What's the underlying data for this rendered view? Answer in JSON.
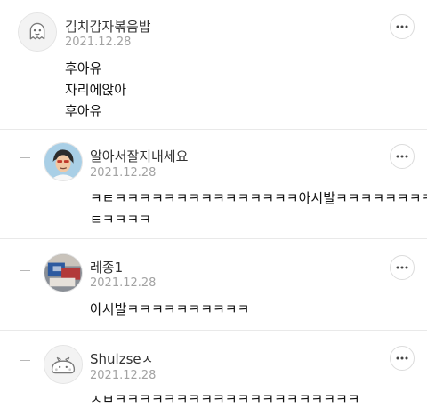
{
  "comments": [
    {
      "author": "김치감자볶음밥",
      "date": "2021.12.28",
      "lines": [
        "후아유",
        "자리에앉아",
        "후아유"
      ],
      "avatar_icon": "ghost-default-avatar-icon",
      "is_reply": false
    },
    {
      "author": "알아서잘지내세요",
      "date": "2021.12.28",
      "lines": [
        "ㅋㅌㅋㅋㅋㅋㅋㅋㅋㅋㅋㅋㅋㅋㅋㅋㅋ아시발ㅋㅋㅋㅋㅋㅋㅋㅋ",
        "ㅌㅋㅋㅋㅋ"
      ],
      "avatar_icon": "cartoon-person-avatar-icon",
      "is_reply": true
    },
    {
      "author": "레종1",
      "date": "2021.12.28",
      "lines": [
        "아시발ㅋㅋㅋㅋㅋㅋㅋㅋㅋㅋ"
      ],
      "avatar_icon": "photo-avatar-icon",
      "is_reply": true
    },
    {
      "author": "Shulzseㅈ",
      "date": "2021.12.28",
      "lines": [
        "ㅅㅂㅋㅋㅋㅋㅋㅋㅋㅋㅋㅋㅋㅋㅋㅋㅋㅋㅋㅋㅋㅋ"
      ],
      "avatar_icon": "blob-default-avatar-icon",
      "is_reply": true
    }
  ],
  "icons": {
    "more": "more-options-icon",
    "reply_indicator": "reply-arrow-icon"
  },
  "colors": {
    "text": "#111111",
    "author": "#333333",
    "date": "#a3a3a3",
    "divider": "#e9e9e9"
  }
}
